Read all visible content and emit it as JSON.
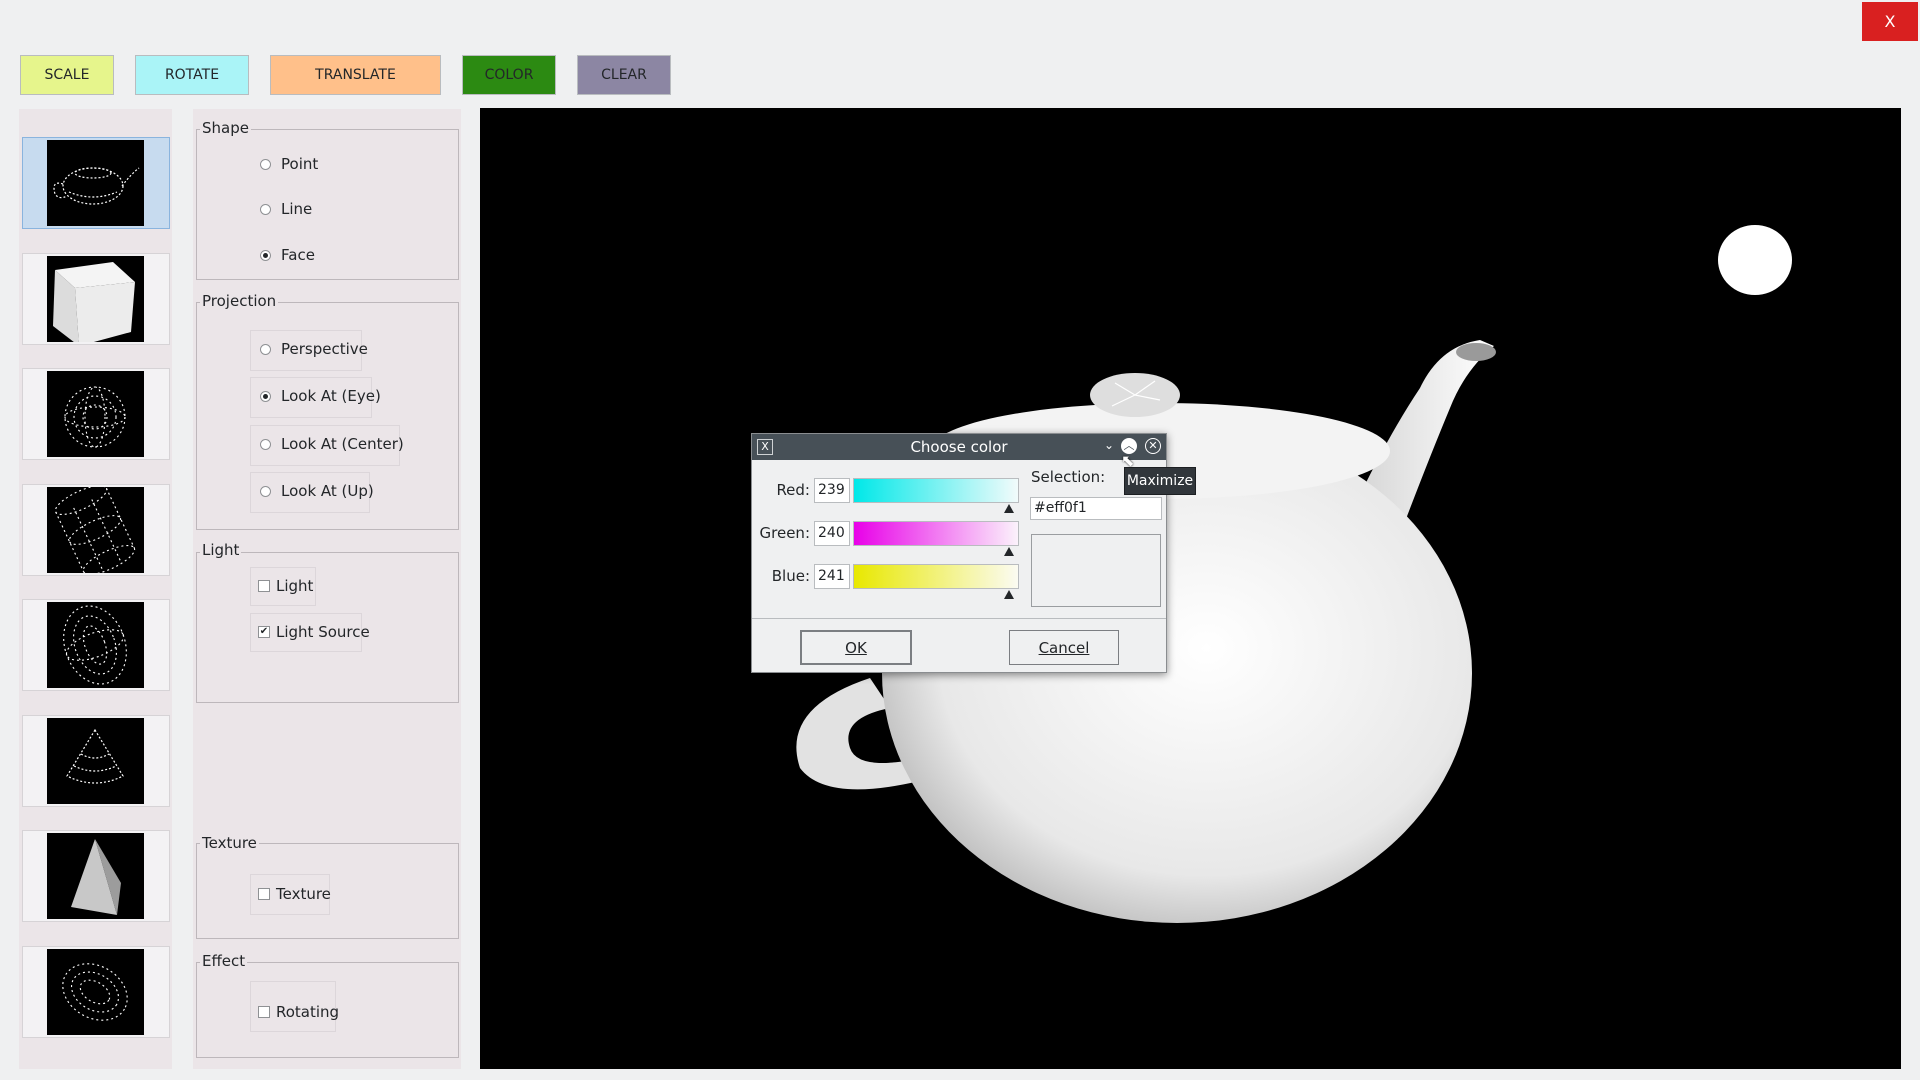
{
  "window": {
    "close_label": "X"
  },
  "toolbar": {
    "scale": "SCALE",
    "rotate": "ROTATE",
    "translate": "TRANSLATE",
    "color": "COLOR",
    "clear": "CLEAR",
    "colors": {
      "scale": "#e6f58c",
      "rotate": "#aaf4f7",
      "translate": "#ffc08a",
      "color": "#2c8a12",
      "clear": "#8c86a3"
    }
  },
  "thumbnails": [
    {
      "name": "teapot-wire",
      "selected": true
    },
    {
      "name": "cube-solid",
      "selected": false
    },
    {
      "name": "sphere-wire",
      "selected": false
    },
    {
      "name": "cylinder-wire",
      "selected": false
    },
    {
      "name": "ellipsoid-wire",
      "selected": false
    },
    {
      "name": "cone-wire",
      "selected": false
    },
    {
      "name": "pyramid-solid",
      "selected": false
    },
    {
      "name": "torus-wire",
      "selected": false
    }
  ],
  "shape": {
    "title": "Shape",
    "point": "Point",
    "line": "Line",
    "face": "Face",
    "selected": "Face"
  },
  "projection": {
    "title": "Projection",
    "perspective": "Perspective",
    "look_eye": "Look At (Eye)",
    "look_center": "Look At (Center)",
    "look_up": "Look At (Up)",
    "selected": "Look At (Eye)"
  },
  "light": {
    "title": "Light",
    "light": "Light",
    "light_source": "Light Source",
    "light_checked": false,
    "light_source_checked": true
  },
  "texture": {
    "title": "Texture",
    "texture": "Texture",
    "checked": false
  },
  "effect": {
    "title": "Effect",
    "rotating": "Rotating",
    "checked": false
  },
  "dialog": {
    "title": "Choose color",
    "red_label": "Red:",
    "red": "239",
    "green_label": "Green:",
    "green": "240",
    "blue_label": "Blue:",
    "blue": "241",
    "selection_label": "Selection:",
    "selection_value": "#eff0f1",
    "ok": "OK",
    "cancel": "Cancel",
    "titlebar_color": "#475057"
  },
  "tooltip": {
    "text": "Maximize"
  }
}
